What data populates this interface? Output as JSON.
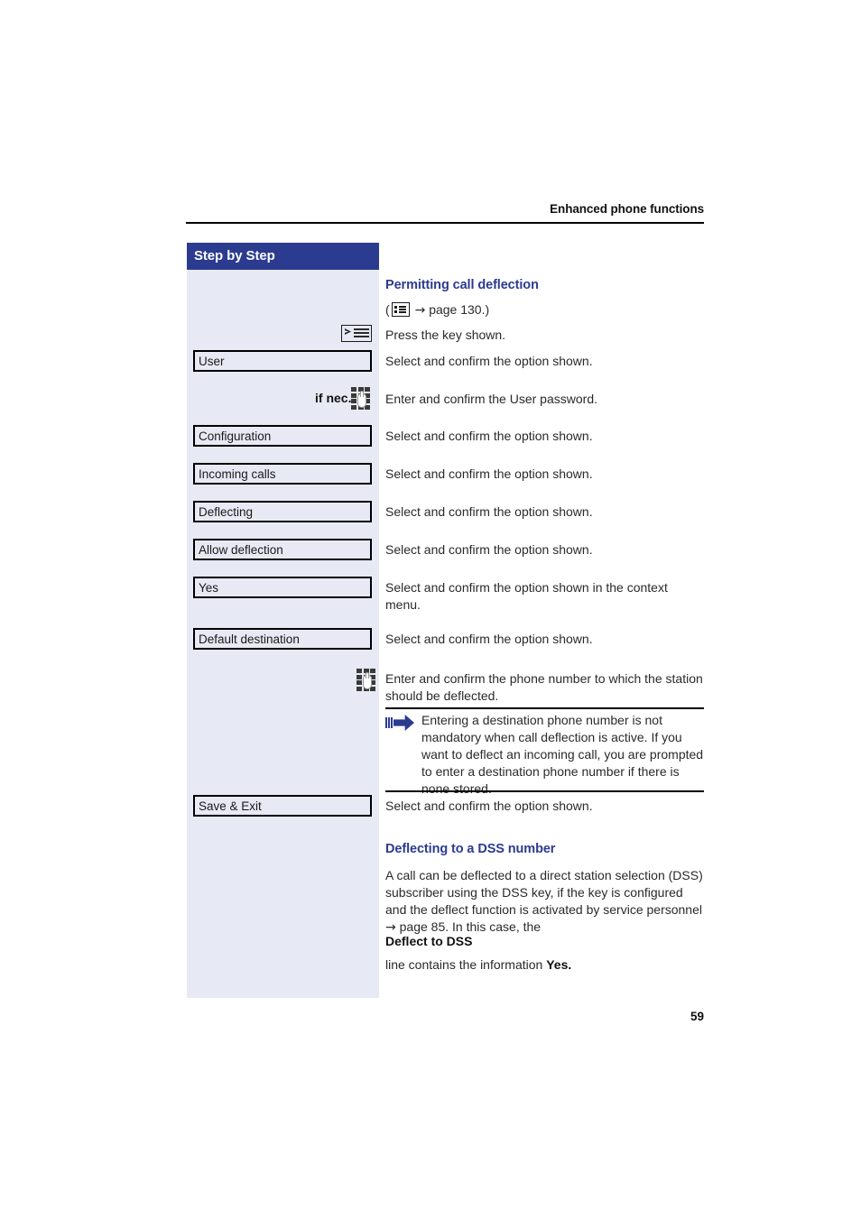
{
  "header": {
    "running_head": "Enhanced phone functions"
  },
  "sidebar": {
    "title": "Step by Step"
  },
  "sections": [
    {
      "heading": "Permitting call deflection",
      "reference_prefix": "(",
      "reference_arrow": "→",
      "reference_text": "page 130.)",
      "reference_icon": "list-menu-icon"
    }
  ],
  "steps": [
    {
      "icon": "key-icon",
      "box_label": null,
      "pre_label": null,
      "instruction": "Press the key shown."
    },
    {
      "icon": null,
      "box_label": "User",
      "pre_label": null,
      "instruction": "Select and confirm the option shown."
    },
    {
      "icon": "keypad-icon",
      "box_label": null,
      "pre_label": "if nec.",
      "instruction": "Enter and confirm the User password."
    },
    {
      "icon": null,
      "box_label": "Configuration",
      "pre_label": null,
      "instruction": "Select and confirm the option shown."
    },
    {
      "icon": null,
      "box_label": "Incoming calls",
      "pre_label": null,
      "instruction": "Select and confirm the option shown."
    },
    {
      "icon": null,
      "box_label": "Deflecting",
      "pre_label": null,
      "instruction": "Select and confirm the option shown."
    },
    {
      "icon": null,
      "box_label": "Allow deflection",
      "pre_label": null,
      "instruction": "Select and confirm the option shown."
    },
    {
      "icon": null,
      "box_label": "Yes",
      "pre_label": null,
      "instruction": "Select and confirm the option shown in the context menu."
    },
    {
      "icon": null,
      "box_label": "Default destination",
      "pre_label": null,
      "instruction": "Select and confirm the option shown."
    },
    {
      "icon": "keypad-icon",
      "box_label": null,
      "pre_label": null,
      "instruction": "Enter and confirm the phone number to which the station should be deflected."
    },
    {
      "icon": null,
      "box_label": "Save & Exit",
      "pre_label": null,
      "instruction": "Select and confirm the option shown."
    }
  ],
  "note": {
    "icon": "note-arrow-icon",
    "text": "Entering a destination phone number is not mandatory when call deflection is active. If you want to deflect an incoming call, you are prompted to enter a destination phone number if there is none stored."
  },
  "dss_section": {
    "heading": "Deflecting to a DSS number",
    "paragraph_part1": "A call can be deflected to a direct station selection (DSS) subscriber using the DSS key, if the key is configured and the deflect function is activated by service personnel ",
    "paragraph_arrow": "→",
    "paragraph_part2": " page 85. In this case, the",
    "emphasis_line": "Deflect to DSS",
    "closing_prefix": "line contains the information ",
    "closing_bold": "Yes."
  },
  "footer": {
    "page_number": "59"
  },
  "colors": {
    "accent_navy": "#2b3b8f",
    "panel_bg": "#e7eaf4",
    "text": "#2a2a2a"
  }
}
